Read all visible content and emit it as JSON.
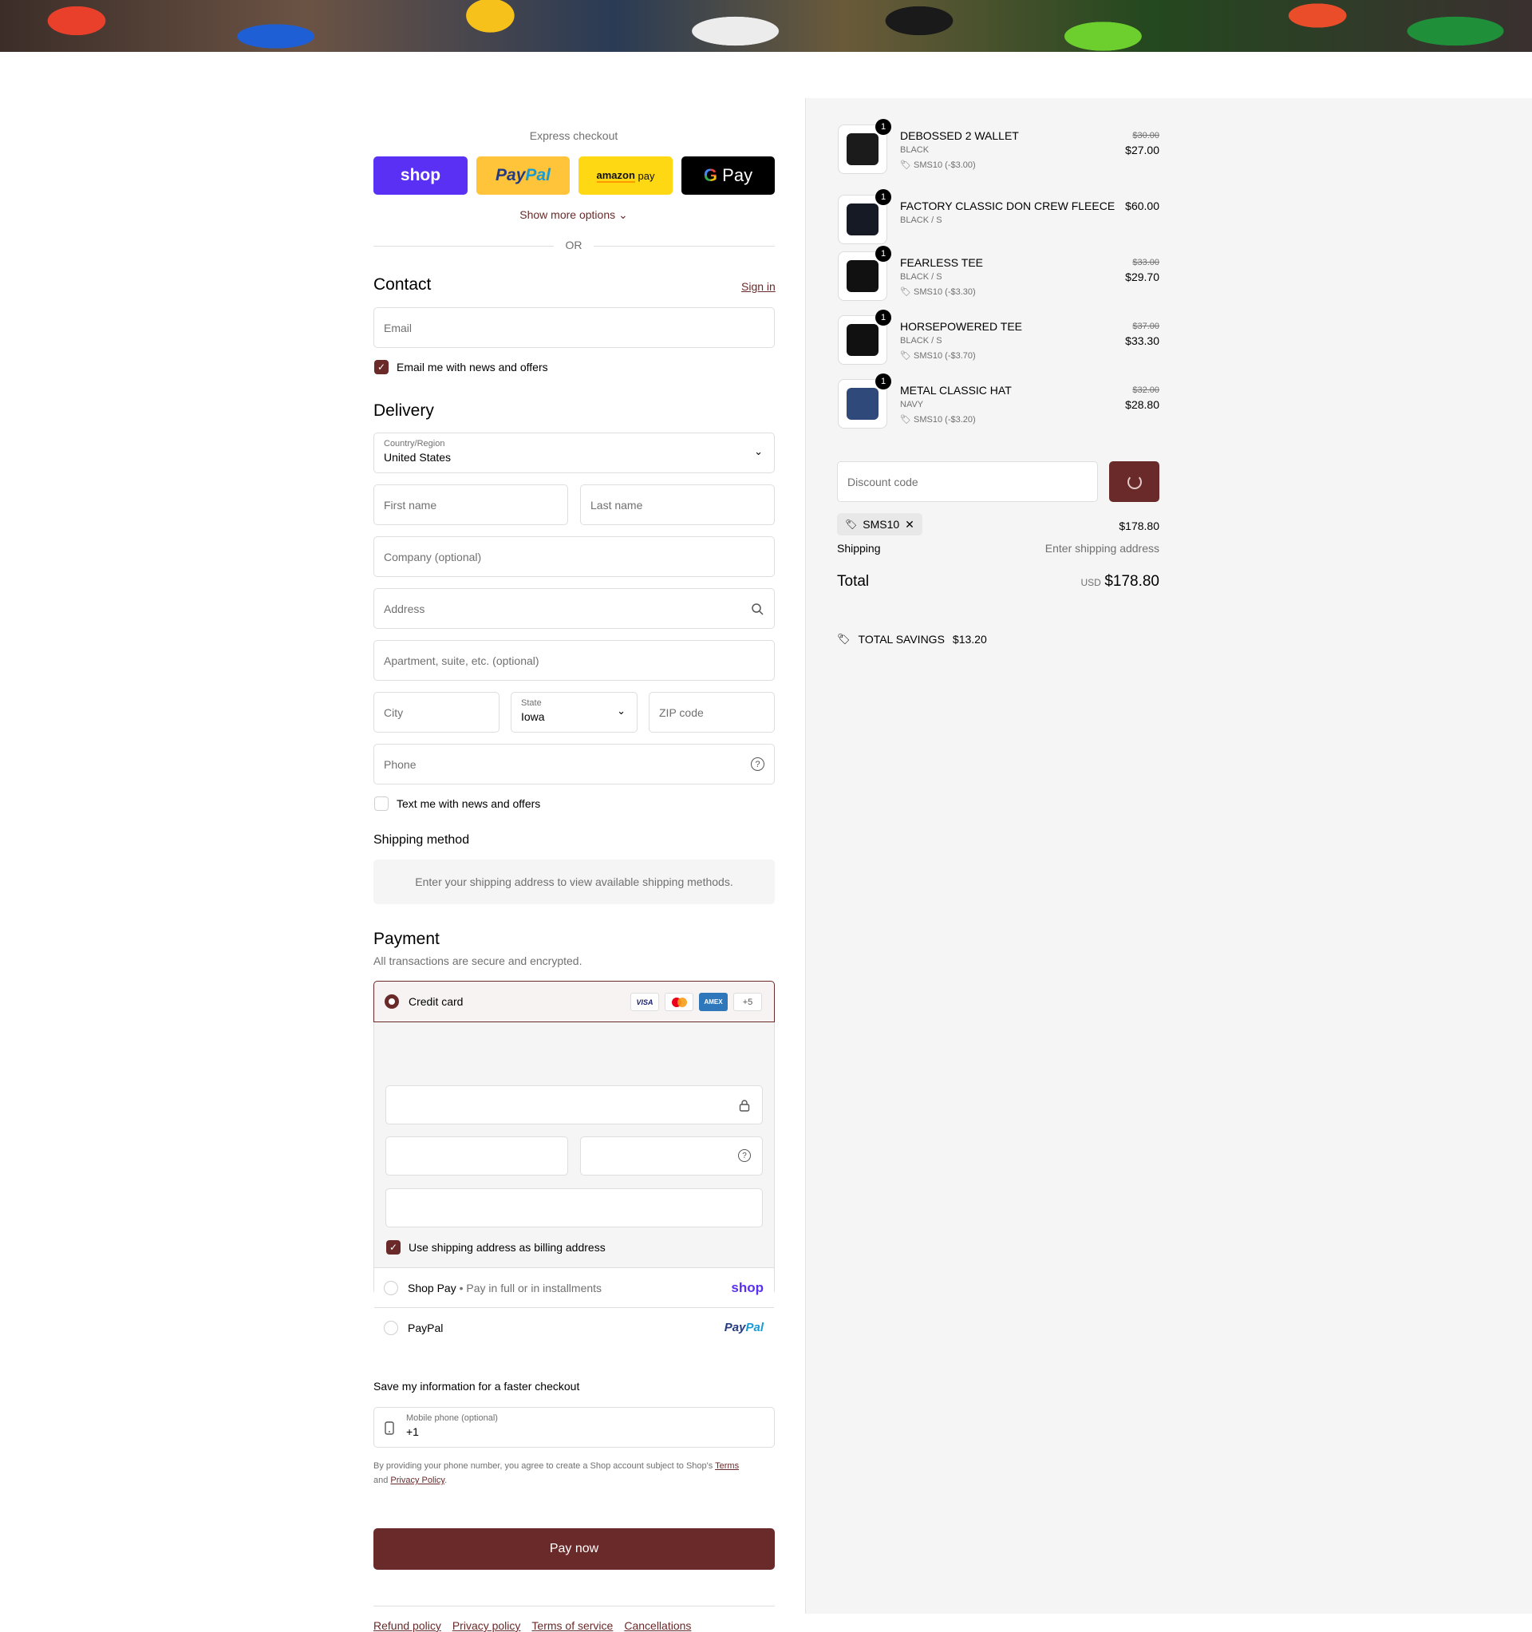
{
  "express": {
    "title": "Express checkout",
    "shop": "shop",
    "paypal_a": "Pay",
    "paypal_b": "Pal",
    "amazon": "amazon",
    "amazon_pay": "pay",
    "gpay": "Pay",
    "show_more": "Show more options",
    "or": "OR"
  },
  "contact": {
    "title": "Contact",
    "sign_in": "Sign in",
    "email_placeholder": "Email",
    "news_label": "Email me with news and offers"
  },
  "delivery": {
    "title": "Delivery",
    "country_label": "Country/Region",
    "country_value": "United States",
    "first_name": "First name",
    "last_name": "Last name",
    "company": "Company (optional)",
    "address": "Address",
    "apartment": "Apartment, suite, etc. (optional)",
    "city": "City",
    "state_label": "State",
    "state_value": "Iowa",
    "zip": "ZIP code",
    "phone": "Phone",
    "text_label": "Text me with news and offers"
  },
  "shipping_method": {
    "title": "Shipping method",
    "notice": "Enter your shipping address to view available shipping methods."
  },
  "payment": {
    "title": "Payment",
    "subtitle": "All transactions are secure and encrypted.",
    "credit_card": "Credit card",
    "visa": "VISA",
    "amex": "AMEX",
    "more": "+5",
    "billing_label": "Use shipping address as billing address",
    "shop_pay": "Shop Pay",
    "shop_pay_desc": "Pay in full or in installments",
    "shop_logo": "shop",
    "paypal": "PayPal",
    "paypal_logo_a": "Pay",
    "paypal_logo_b": "Pal"
  },
  "save_info": {
    "title": "Save my information for a faster checkout",
    "mobile_label": "Mobile phone (optional)",
    "mobile_value": "+1",
    "legal_1": "By providing your phone number, you agree to create a Shop account subject to Shop's",
    "terms": "Terms",
    "and": "and",
    "privacy": "Privacy Policy",
    "period": "."
  },
  "pay_now": "Pay now",
  "footer": {
    "refund": "Refund policy",
    "privacy": "Privacy policy",
    "terms": "Terms of service",
    "cancellations": "Cancellations"
  },
  "cart": {
    "items": [
      {
        "name": "DEBOSSED 2 WALLET",
        "variant": "BLACK",
        "discount": "SMS10 (-$3.00)",
        "original": "$30.00",
        "price": "$27.00",
        "qty": "1",
        "color": "#1b1b1b"
      },
      {
        "name": "FACTORY CLASSIC DON CREW FLEECE",
        "variant": "BLACK / S",
        "discount": "",
        "original": "",
        "price": "$60.00",
        "qty": "1",
        "color": "#151a24"
      },
      {
        "name": "FEARLESS TEE",
        "variant": "BLACK / S",
        "discount": "SMS10 (-$3.30)",
        "original": "$33.00",
        "price": "$29.70",
        "qty": "1",
        "color": "#111111"
      },
      {
        "name": "HORSEPOWERED TEE",
        "variant": "BLACK / S",
        "discount": "SMS10 (-$3.70)",
        "original": "$37.00",
        "price": "$33.30",
        "qty": "1",
        "color": "#111111"
      },
      {
        "name": "METAL CLASSIC HAT",
        "variant": "NAVY",
        "discount": "SMS10 (-$3.20)",
        "original": "$32.00",
        "price": "$28.80",
        "qty": "1",
        "color": "#2f4a7a"
      }
    ],
    "discount_placeholder": "Discount code",
    "applied_code": "SMS10",
    "subtotal": "$178.80",
    "shipping_label": "Shipping",
    "shipping_value": "Enter shipping address",
    "total_label": "Total",
    "currency": "USD",
    "total": "$178.80",
    "savings_label": "TOTAL SAVINGS",
    "savings_value": "$13.20"
  },
  "colors": {
    "accent": "#6a2a2a",
    "shop": "#5a31f4",
    "paypal": "#ffc439",
    "amazon": "#ffd814"
  }
}
